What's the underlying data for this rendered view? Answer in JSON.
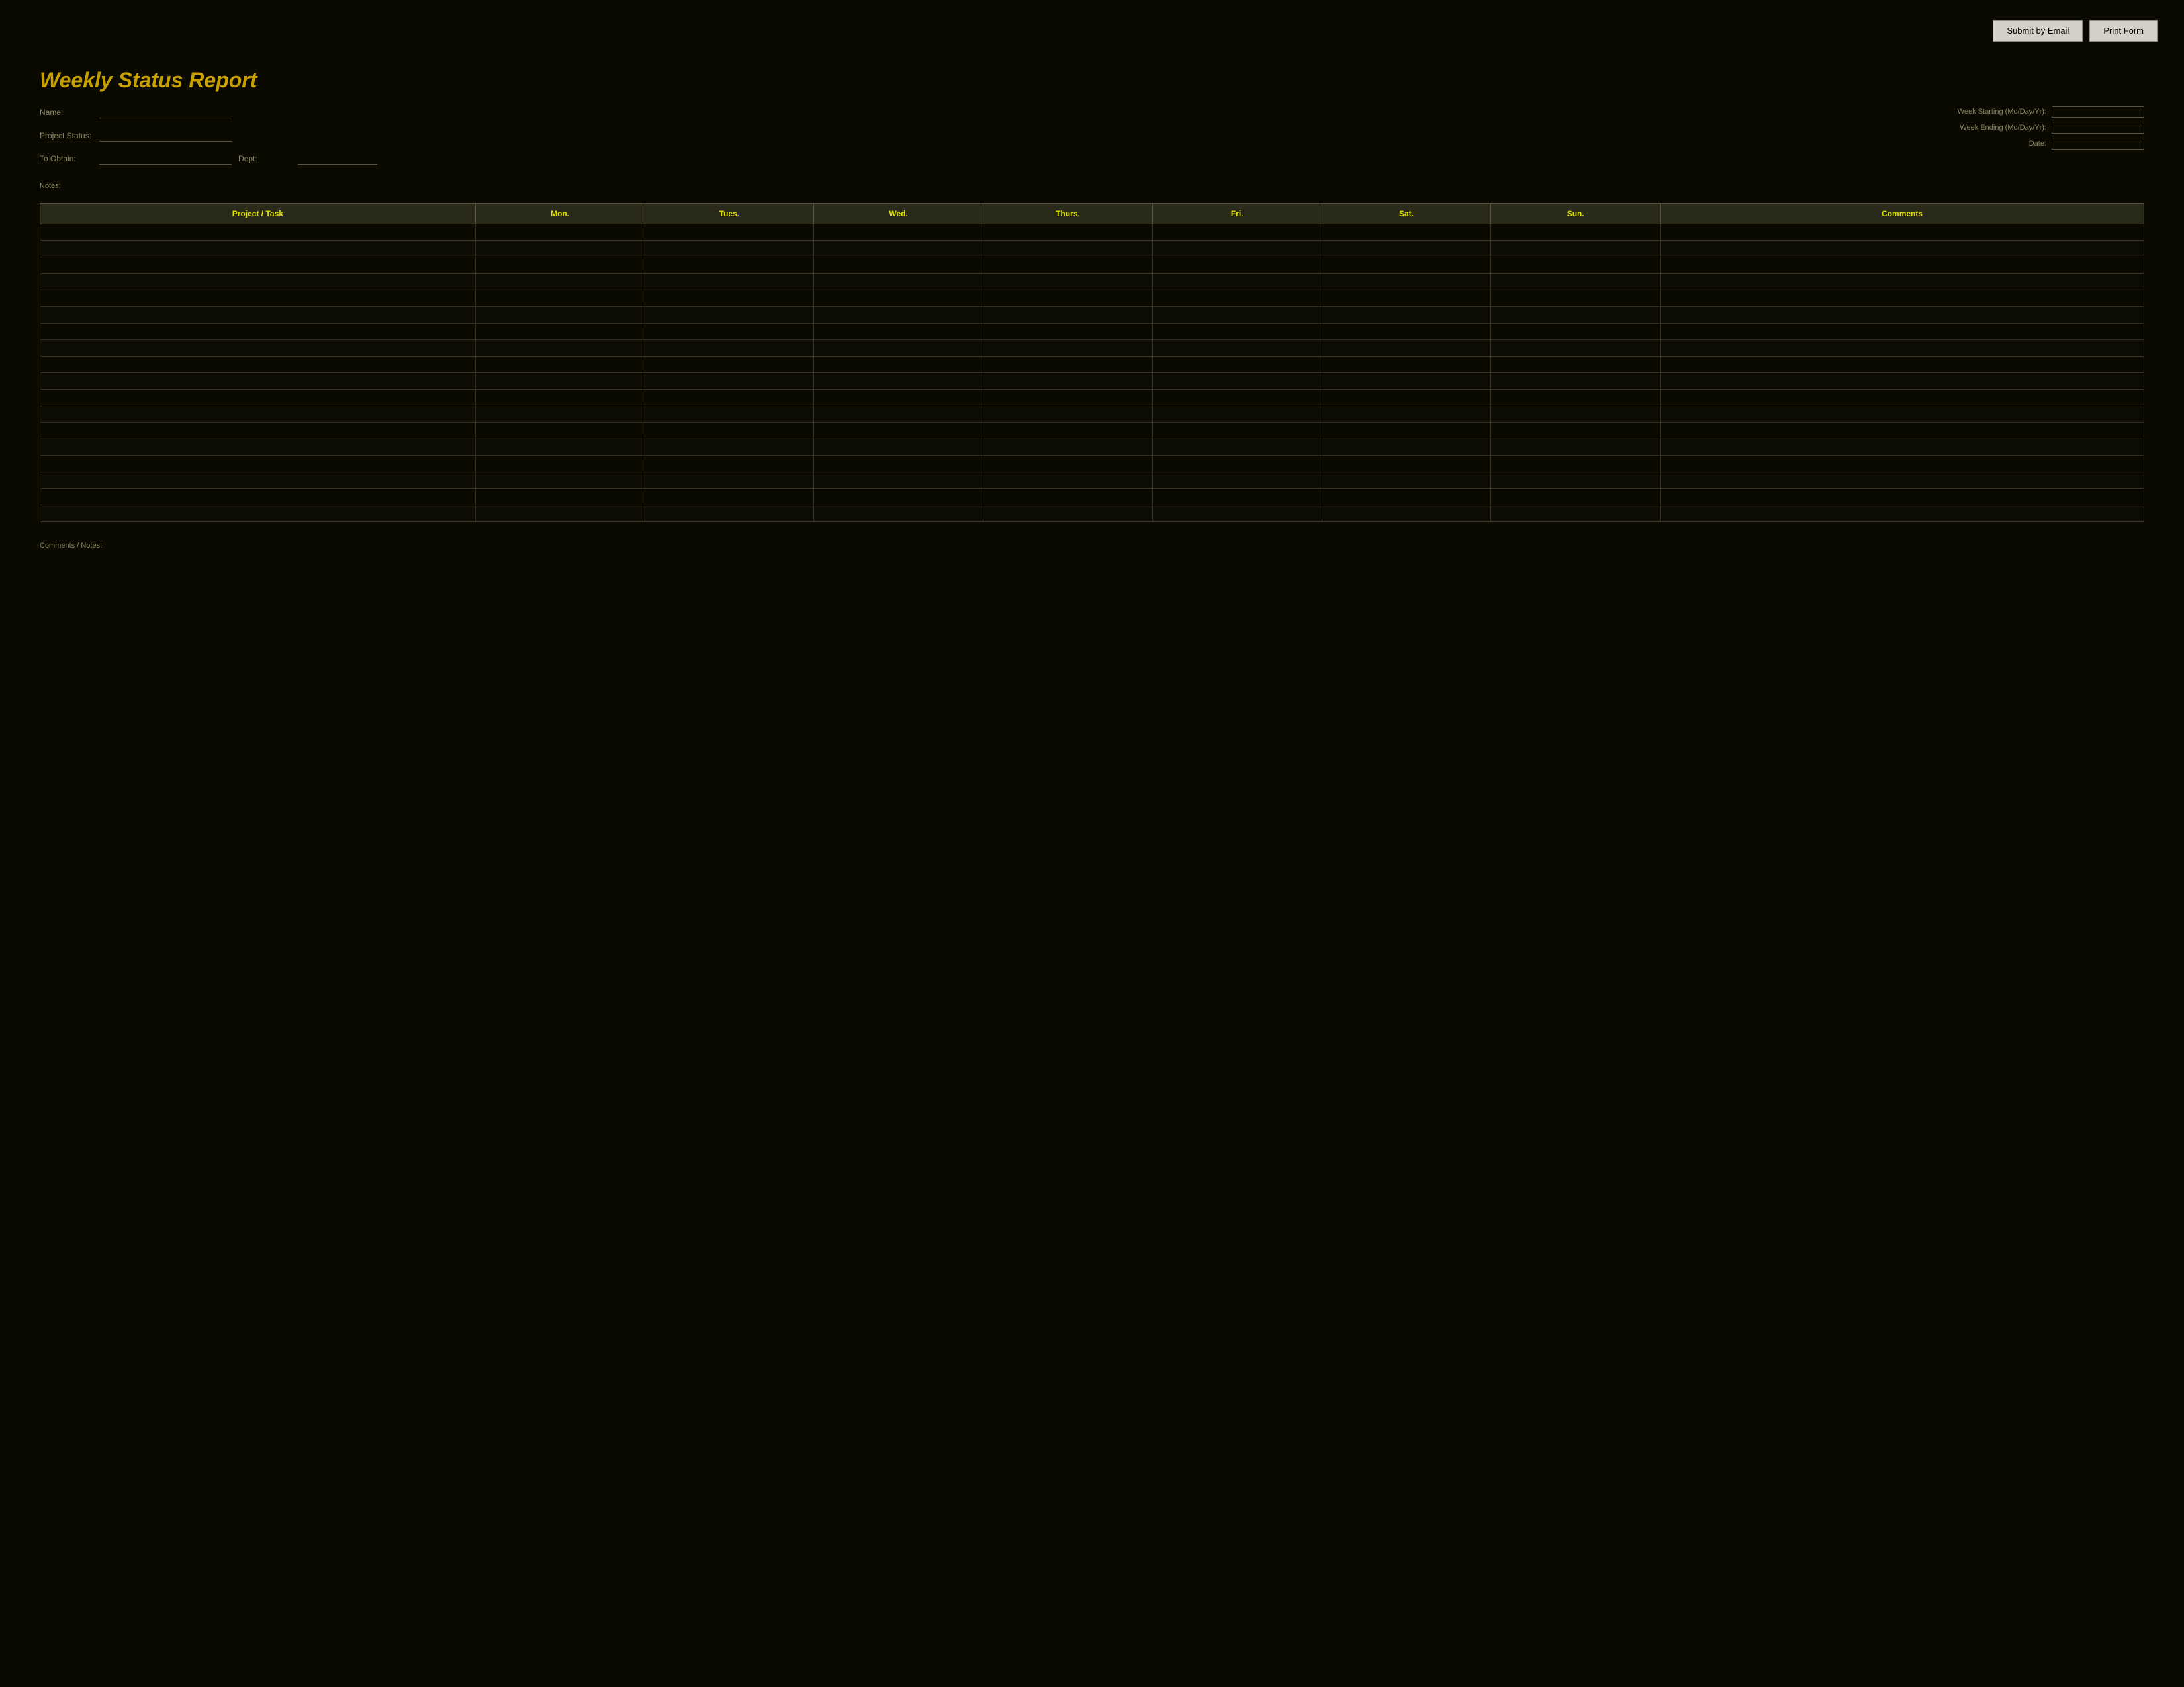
{
  "toolbar": {
    "submit_email_label": "Submit by Email",
    "print_form_label": "Print Form"
  },
  "report": {
    "title": "Weekly Status Report",
    "fields": {
      "name_label": "Name:",
      "name_value": "",
      "project_status_label": "Project Status:",
      "project_status_value": "",
      "to_obtain_label": "To Obtain:",
      "to_obtain_value": "",
      "dept_label": "Dept:"
    },
    "right_fields": {
      "week_starting_label": "Week Starting (Mo/Day/Yr):",
      "week_starting_value": "",
      "week_ending_label": "Week Ending (Mo/Day/Yr):",
      "week_ending_value": "",
      "date_label": "Date:",
      "date_value": ""
    },
    "notes_label": "Notes:"
  },
  "table": {
    "headers": [
      {
        "key": "project_task",
        "label": "Project / Task"
      },
      {
        "key": "mon",
        "label": "Mon."
      },
      {
        "key": "tues",
        "label": "Tues."
      },
      {
        "key": "wed",
        "label": "Wed."
      },
      {
        "key": "thurs",
        "label": "Thurs."
      },
      {
        "key": "fri",
        "label": "Fri."
      },
      {
        "key": "sat",
        "label": "Sat."
      },
      {
        "key": "sun",
        "label": "Sun."
      },
      {
        "key": "comments",
        "label": "Comments"
      }
    ],
    "row_count": 18
  },
  "bottom": {
    "summary_label": "Comments / Notes:",
    "summary_value": ""
  }
}
